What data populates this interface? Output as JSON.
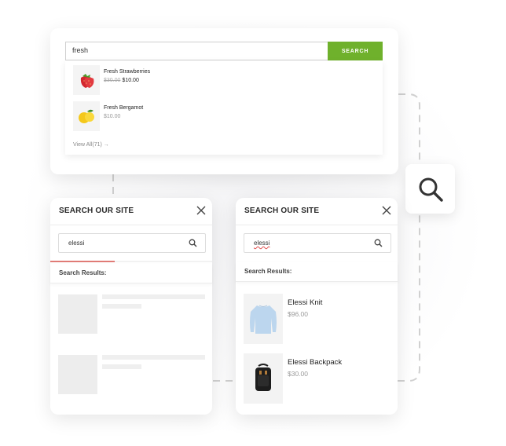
{
  "top_search": {
    "query": "fresh",
    "button_label": "SEARCH",
    "results": [
      {
        "name": "Fresh Strawberries",
        "old_price": "$30.00",
        "price": "$10.00"
      },
      {
        "name": "Fresh Bergamot",
        "price": "$10.00"
      }
    ],
    "view_all": "View All(71) →"
  },
  "panel_left": {
    "title": "SEARCH OUR SITE",
    "query": "elessi",
    "results_label": "Search Results:",
    "progress": 0.4
  },
  "panel_right": {
    "title": "SEARCH OUR SITE",
    "query": "elessi",
    "results_label": "Search Results:",
    "results": [
      {
        "name": "Elessi Knit",
        "price": "$96.00"
      },
      {
        "name": "Elessi Backpack",
        "price": "$30.00"
      }
    ]
  },
  "icons": {
    "search": "search-icon",
    "close": "close-icon",
    "arrow": "arrow-right-icon"
  },
  "colors": {
    "accent_green": "#6fb12c",
    "progress_red": "#e07b76",
    "dash_gray": "#cfcfcf"
  }
}
